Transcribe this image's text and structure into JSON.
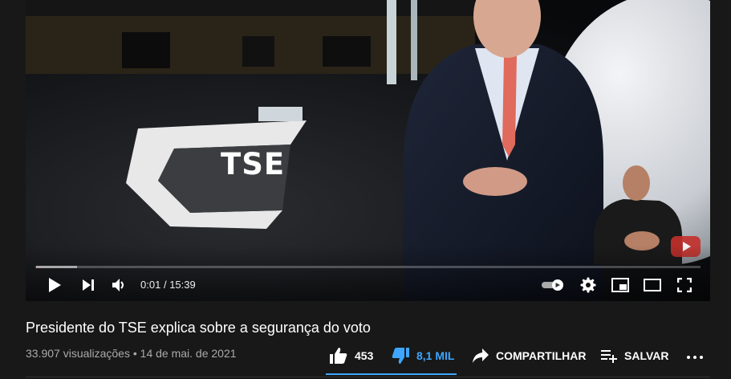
{
  "player": {
    "overlay_logo_text": "TSE",
    "time_current": "0:01",
    "time_separator": "/",
    "time_total": "15:39",
    "progress_played_fraction": 0.001,
    "progress_buffered_fraction": 0.063,
    "icons": {
      "play": "play-icon",
      "next": "next-icon",
      "volume": "volume-icon",
      "autoplay": "autoplay-toggle-icon",
      "settings": "gear-icon",
      "miniplayer": "miniplayer-icon",
      "theater": "theater-mode-icon",
      "fullscreen": "fullscreen-icon"
    }
  },
  "video": {
    "title": "Presidente do TSE explica sobre a segurança do voto",
    "views": "33.907 visualizações",
    "separator": "•",
    "date": "14 de mai. de 2021"
  },
  "actions": {
    "like_count": "453",
    "dislike_count": "8,1 MIL",
    "share_label": "COMPARTILHAR",
    "save_label": "SALVAR",
    "like_ratio": 0.05
  },
  "colors": {
    "background": "#181818",
    "accent_blue": "#3ea6ff",
    "progress_red": "#ff0000",
    "meta_gray": "#aaaaaa"
  }
}
